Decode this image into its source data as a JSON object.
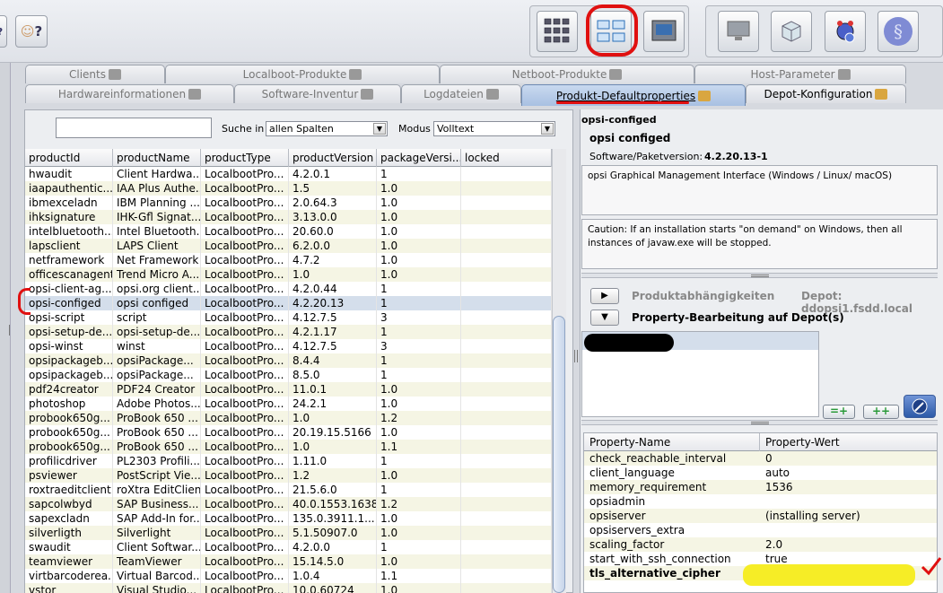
{
  "toolbar": {
    "left_buttons": [
      {
        "icon": "help-icon"
      },
      {
        "icon": "users-help-icon",
        "label": "?"
      }
    ],
    "mid_buttons": [
      {
        "icon": "client-grid-icon"
      },
      {
        "icon": "depot-grid-icon"
      },
      {
        "icon": "server-console-icon"
      }
    ],
    "right_buttons": [
      {
        "icon": "monitor-icon"
      },
      {
        "icon": "package-icon"
      },
      {
        "icon": "license-icon"
      },
      {
        "icon": "opsi-icon"
      }
    ]
  },
  "tabs_row1": [
    {
      "label": "Clients",
      "icon": "monitor-icon"
    },
    {
      "label": "Localboot-Produkte",
      "icon": "cube-icon"
    },
    {
      "label": "Netboot-Produkte",
      "icon": "netboot-icon"
    },
    {
      "label": "Host-Parameter",
      "icon": "tools-icon"
    }
  ],
  "tabs_row2": [
    {
      "label": "Hardwareinformationen",
      "icon": "hardware-icon"
    },
    {
      "label": "Software-Inventur",
      "icon": "software-icon"
    },
    {
      "label": "Logdateien",
      "icon": "log-icon"
    },
    {
      "label": "Produkt-Defaultproperties",
      "icon": "tools-icon",
      "active": true
    },
    {
      "label": "Depot-Konfiguration",
      "icon": "tools-icon"
    }
  ],
  "search": {
    "value": "",
    "label": "Suche in",
    "column_select": "allen Spalten",
    "mode_label": "Modus",
    "mode_select": "Volltext"
  },
  "columns": [
    "productId",
    "productName",
    "productType",
    "productVersion",
    "packageVersi...",
    "locked"
  ],
  "rows": [
    [
      "hwaudit",
      "Client Hardwa...",
      "LocalbootPro...",
      "4.2.0.1",
      "1",
      ""
    ],
    [
      "iaapauthentic...",
      "IAA Plus Authe...",
      "LocalbootPro...",
      "1.5",
      "1.0",
      ""
    ],
    [
      "ibmexceladn",
      "IBM Planning ...",
      "LocalbootPro...",
      "2.0.64.3",
      "1.0",
      ""
    ],
    [
      "ihksignature",
      "IHK-Gfl Signat...",
      "LocalbootPro...",
      "3.13.0.0",
      "1.0",
      ""
    ],
    [
      "intelbluetooth...",
      "Intel Bluetooth...",
      "LocalbootPro...",
      "20.60.0",
      "1.0",
      ""
    ],
    [
      "lapsclient",
      "LAPS Client",
      "LocalbootPro...",
      "6.2.0.0",
      "1.0",
      ""
    ],
    [
      "netframework",
      "Net Framework",
      "LocalbootPro...",
      "4.7.2",
      "1.0",
      ""
    ],
    [
      "officescanagent",
      "Trend Micro A...",
      "LocalbootPro...",
      "1.0",
      "1.0",
      ""
    ],
    [
      "opsi-client-ag...",
      "opsi.org client...",
      "LocalbootPro...",
      "4.2.0.44",
      "1",
      ""
    ],
    [
      "opsi-configed",
      "opsi configed",
      "LocalbootPro...",
      "4.2.20.13",
      "1",
      ""
    ],
    [
      "opsi-script",
      "script",
      "LocalbootPro...",
      "4.12.7.5",
      "3",
      ""
    ],
    [
      "opsi-setup-de...",
      "opsi-setup-de...",
      "LocalbootPro...",
      "4.2.1.17",
      "1",
      ""
    ],
    [
      "opsi-winst",
      "winst",
      "LocalbootPro...",
      "4.12.7.5",
      "3",
      ""
    ],
    [
      "opsipackageb...",
      "opsiPackage...",
      "LocalbootPro...",
      "8.4.4",
      "1",
      ""
    ],
    [
      "opsipackageb...",
      "opsiPackage...",
      "LocalbootPro...",
      "8.5.0",
      "1",
      ""
    ],
    [
      "pdf24creator",
      "PDF24 Creator",
      "LocalbootPro...",
      "11.0.1",
      "1.0",
      ""
    ],
    [
      "photoshop",
      "Adobe Photos...",
      "LocalbootPro...",
      "24.2.1",
      "1.0",
      ""
    ],
    [
      "probook650g...",
      "ProBook 650 ...",
      "LocalbootPro...",
      "1.0",
      "1.2",
      ""
    ],
    [
      "probook650g...",
      "ProBook 650 ...",
      "LocalbootPro...",
      "20.19.15.5166",
      "1.0",
      ""
    ],
    [
      "probook650g...",
      "ProBook 650 ...",
      "LocalbootPro...",
      "1.0",
      "1.1",
      ""
    ],
    [
      "profilicdriver",
      "PL2303 Profili...",
      "LocalbootPro...",
      "1.11.0",
      "1",
      ""
    ],
    [
      "psviewer",
      "PostScript Vie...",
      "LocalbootPro...",
      "1.2",
      "1.0",
      ""
    ],
    [
      "roxtraeditclient",
      "roXtra EditClient",
      "LocalbootPro...",
      "21.5.6.0",
      "1",
      ""
    ],
    [
      "sapcolwbyd",
      "SAP Business...",
      "LocalbootPro...",
      "40.0.1553.1638",
      "1.2",
      ""
    ],
    [
      "sapexcladn",
      "SAP Add-In for...",
      "LocalbootPro...",
      "135.0.3911.1...",
      "1.0",
      ""
    ],
    [
      "silverligth",
      "Silverlight",
      "LocalbootPro...",
      "5.1.50907.0",
      "1.0",
      ""
    ],
    [
      "swaudit",
      "Client Softwar...",
      "LocalbootPro...",
      "4.2.0.0",
      "1",
      ""
    ],
    [
      "teamviewer",
      "TeamViewer",
      "LocalbootPro...",
      "15.14.5.0",
      "1.0",
      ""
    ],
    [
      "virtbarcoderea...",
      "Virtual Barcod...",
      "LocalbootPro...",
      "1.0.4",
      "1.1",
      ""
    ],
    [
      "vstor",
      "Visual Studio...",
      "LocalbootPro...",
      "10.0.60724",
      "1.0",
      ""
    ]
  ],
  "selected_row": 9,
  "detail": {
    "header": "opsi-configed",
    "name": "opsi configed",
    "version_label": "Software/Paketversion:",
    "version_value": "4.2.20.13-1",
    "description": "opsi Graphical Management Interface (Windows / Linux/ macOS)",
    "advice": "Caution: If an installation starts \"on demand\" on Windows, then all instances of javaw.exe will be stopped.",
    "dependencies_label": "Produktabhängigkeiten",
    "depot_label": "Depot: ddopsi1.fsdd.local",
    "property_edit_label": "Property-Bearbeitung auf Depot(s)",
    "btn_set": "=+",
    "btn_add": "++"
  },
  "properties": {
    "headers": [
      "Property-Name",
      "Property-Wert"
    ],
    "rows": [
      [
        "check_reachable_interval",
        "0"
      ],
      [
        "client_language",
        "auto"
      ],
      [
        "memory_requirement",
        "1536"
      ],
      [
        "opsiadmin",
        ""
      ],
      [
        "opsiserver",
        "(installing server)"
      ],
      [
        "opsiservers_extra",
        ""
      ],
      [
        "scaling_factor",
        "2.0"
      ],
      [
        "start_with_ssh_connection",
        "true"
      ],
      [
        "tls_alternative_cipher",
        ""
      ]
    ]
  }
}
